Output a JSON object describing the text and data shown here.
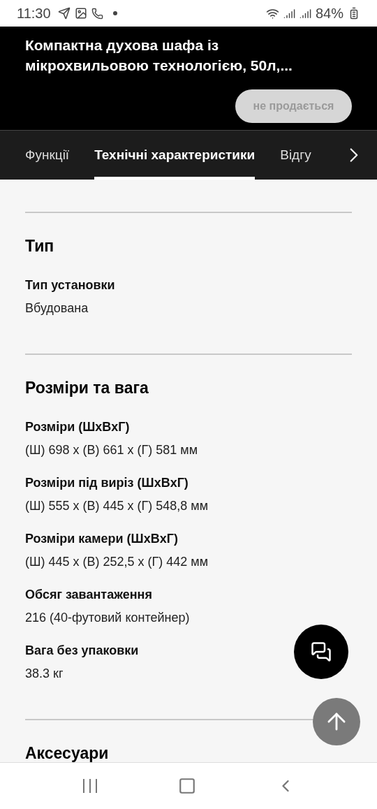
{
  "status_bar": {
    "time": "11:30",
    "battery": "84%"
  },
  "header": {
    "title": "Компактна духова шафа із мікрохвильовою технологією, 50л,...",
    "button": {
      "label": "не продається",
      "disabled": true
    }
  },
  "tabs": [
    {
      "label": "Функції",
      "selected": false
    },
    {
      "label": "Технічні характеристики",
      "selected": true
    },
    {
      "label": "Відгу",
      "selected": false
    }
  ],
  "sections": [
    {
      "title": "Тип",
      "specs": [
        {
          "label": "Тип установки",
          "value": "Вбудована"
        }
      ]
    },
    {
      "title": "Розміри та вага",
      "specs": [
        {
          "label": "Розміри (ШxВxГ)",
          "value": "(Ш) 698 x (В) 661 x (Г) 581 мм"
        },
        {
          "label": "Розміри під виріз (ШxВxГ)",
          "value": "(Ш) 555 x (В) 445 x (Г) 548,8 мм"
        },
        {
          "label": "Розміри камери (ШxВxГ)",
          "value": "(Ш) 445 x (В) 252,5 x (Г) 442 мм"
        },
        {
          "label": "Обсяг завантаження",
          "value": "216 (40-футовий контейнер)"
        },
        {
          "label": "Вага без упаковки",
          "value": "38.3 кг"
        }
      ]
    },
    {
      "title": "Аксесуари"
    }
  ]
}
